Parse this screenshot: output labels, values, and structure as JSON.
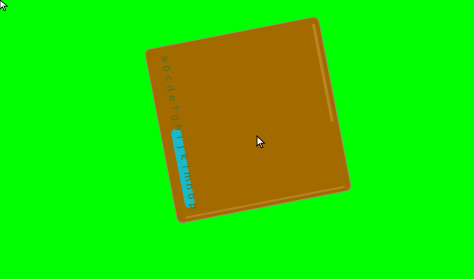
{
  "screen": {
    "background_color": "#00ff00",
    "panel_color": "#a36a00",
    "accent_color": "#1cb8c8"
  },
  "list": {
    "letters": [
      "a",
      "b",
      "c",
      "d",
      "e",
      "f",
      "g",
      "h",
      "i",
      "j",
      "k",
      "l",
      "m",
      "n",
      "o",
      "p"
    ]
  },
  "icons": {
    "top_cursor": "arrow-cursor-icon",
    "pointer_cursor": "arrow-cursor-icon"
  }
}
